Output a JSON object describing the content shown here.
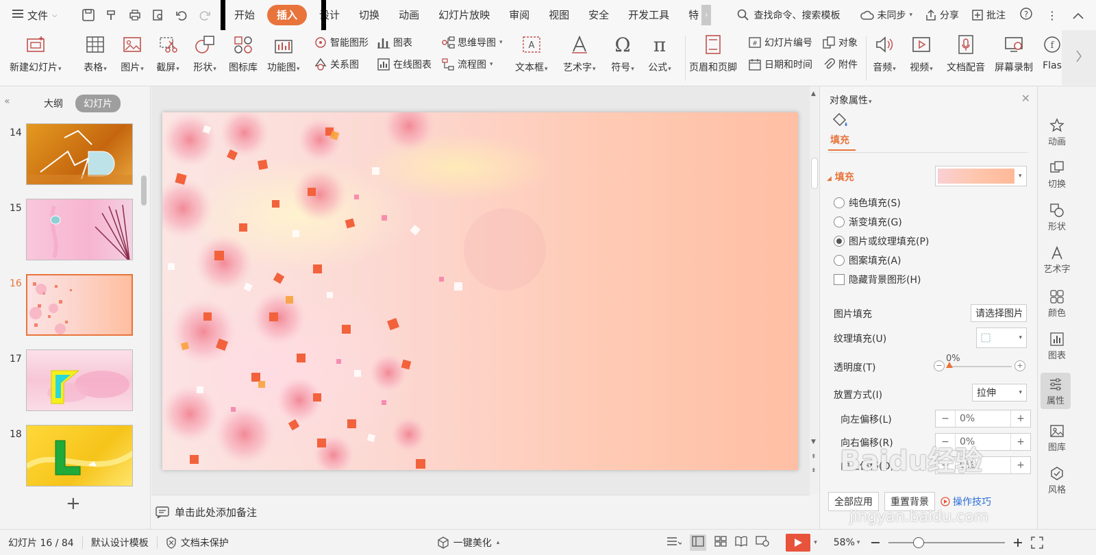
{
  "menubar": {
    "file_label": "文件",
    "tabs": [
      "开始",
      "插入",
      "设计",
      "切换",
      "动画",
      "幻灯片放映",
      "审阅",
      "视图",
      "安全",
      "开发工具",
      "特"
    ],
    "active_tab": "插入",
    "search_label": "查找命令、搜索模板",
    "sync_label": "未同步",
    "share_label": "分享",
    "comment_label": "批注"
  },
  "ribbon": {
    "new_slide": "新建幻灯片",
    "table": "表格",
    "picture": "图片",
    "screenshot": "截屏",
    "shape": "形状",
    "icon_library": "图标库",
    "function_chart": "功能图",
    "smart_graphic": "智能图形",
    "chart": "图表",
    "relation_chart": "关系图",
    "online_chart": "在线图表",
    "mind_map": "思维导图",
    "flowchart": "流程图",
    "textbox": "文本框",
    "wordart": "艺术字",
    "symbol": "符号",
    "formula": "公式",
    "header_footer": "页眉和页脚",
    "slide_number": "幻灯片编号",
    "object": "对象",
    "date_time": "日期和时间",
    "attachment": "附件",
    "audio": "音频",
    "video": "视频",
    "narration": "文档配音",
    "screen_record": "屏幕录制",
    "flash": "Flas"
  },
  "left_panel": {
    "tab_outline": "大纲",
    "tab_slides": "幻灯片",
    "slides": [
      {
        "num": "14"
      },
      {
        "num": "15"
      },
      {
        "num": "16"
      },
      {
        "num": "17"
      },
      {
        "num": "18"
      }
    ],
    "selected": "16"
  },
  "notes_placeholder": "单击此处添加备注",
  "properties": {
    "title": "对象属性",
    "tab_fill": "填充",
    "section_fill": "填充",
    "options": [
      {
        "label": "纯色填充(S)",
        "checked": false
      },
      {
        "label": "渐变填充(G)",
        "checked": false
      },
      {
        "label": "图片或纹理填充(P)",
        "checked": true
      },
      {
        "label": "图案填充(A)",
        "checked": false
      }
    ],
    "hide_bg_label": "隐藏背景图形(H)",
    "picture_fill_label": "图片填充",
    "picture_fill_value": "请选择图片",
    "texture_fill_label": "纹理填充(U)",
    "transparency_label": "透明度(T)",
    "transparency_value": "0%",
    "placement_label": "放置方式(I)",
    "placement_value": "拉伸",
    "offset_left_label": "向左偏移(L)",
    "offset_left_value": "0%",
    "offset_right_label": "向右偏移(R)",
    "offset_right_value": "0%",
    "offset_top_label": "向上偏移(O)",
    "offset_top_value": "0%",
    "apply_all": "全部应用",
    "reset_bg": "重置背景",
    "tips": "操作技巧"
  },
  "right_sidebar": [
    "动画",
    "切换",
    "形状",
    "艺术字",
    "颜色",
    "图表",
    "属性",
    "图库",
    "风格"
  ],
  "right_sidebar_active": "属性",
  "status": {
    "slide_info": "幻灯片 16 / 84",
    "template": "默认设计模板",
    "protect": "文档未保护",
    "beautify": "一键美化",
    "zoom": "58%"
  },
  "watermark": {
    "logo": "Baidu经验",
    "url": "jingyan.baidu.com"
  },
  "colors": {
    "accent": "#e8743b",
    "play": "#e8533b"
  }
}
